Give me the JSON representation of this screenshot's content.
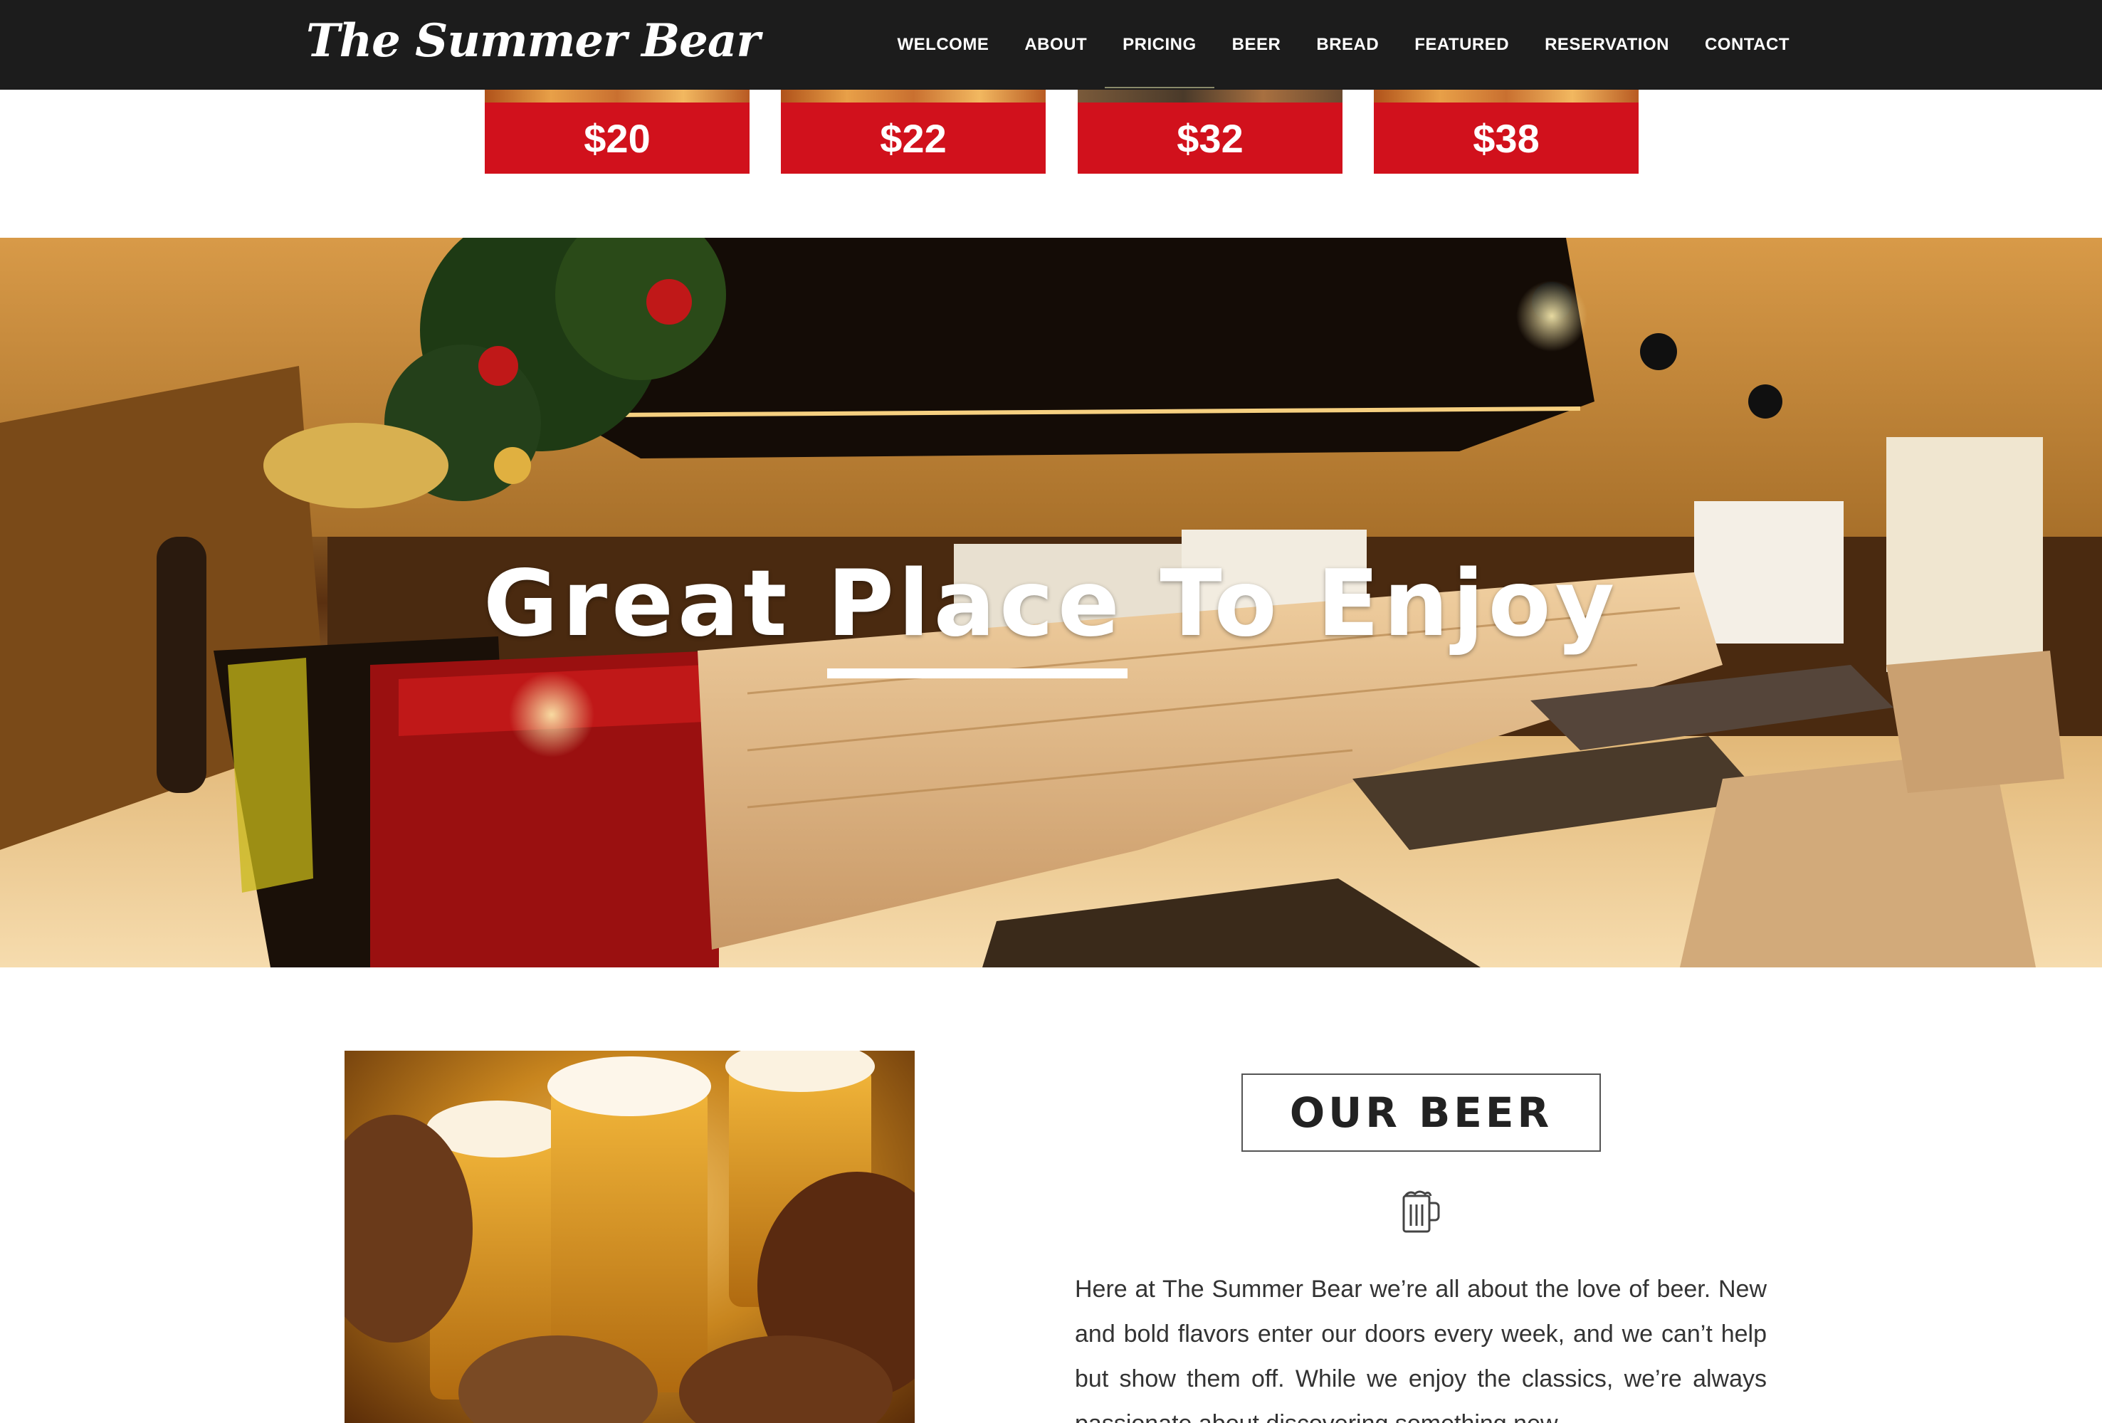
{
  "navbar": {
    "brand": "The Summer Bear",
    "items": [
      {
        "label": "WELCOME"
      },
      {
        "label": "ABOUT"
      },
      {
        "label": "PRICING",
        "active": true
      },
      {
        "label": "BEER"
      },
      {
        "label": "BREAD"
      },
      {
        "label": "FEATURED"
      },
      {
        "label": "RESERVATION"
      },
      {
        "label": "CONTACT"
      }
    ]
  },
  "pricing": {
    "cards": [
      {
        "price": "$20"
      },
      {
        "price": "$22"
      },
      {
        "price": "$32"
      },
      {
        "price": "$38"
      }
    ]
  },
  "hero": {
    "title": "Great Place To Enjoy"
  },
  "beer": {
    "heading": "OUR BEER",
    "icon": "beer-mug-icon",
    "text": "Here at The Summer Bear we’re all about the love of beer. New and bold flavors enter our doors every week, and we can’t help but show them off. While we enjoy the classics, we’re always passionate about discovering something new."
  },
  "colors": {
    "navbar_bg": "#1c1c1c",
    "price_red": "#d1111c",
    "text_dark": "#333333"
  }
}
